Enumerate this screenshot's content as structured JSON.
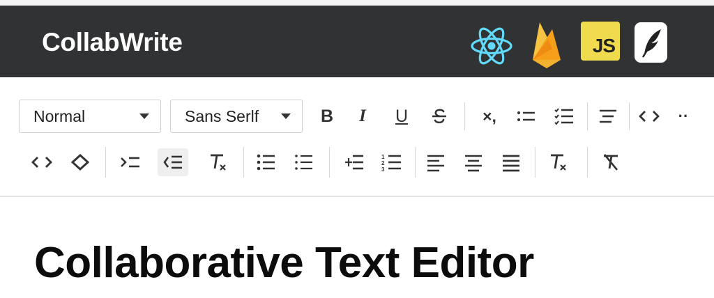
{
  "app": {
    "name": "CollabWrite",
    "tech_icons": [
      "react-icon",
      "firebase-icon",
      "javascript-icon",
      "quill-icon"
    ],
    "tech_js_label": "JS"
  },
  "toolbar": {
    "format_select": {
      "value": "Normal"
    },
    "font_select": {
      "value": "Sans Serlf"
    },
    "row1_buttons": [
      "bold",
      "italic",
      "underline",
      "strike",
      "subscript",
      "list-ordered",
      "list-check",
      "align",
      "code",
      "more"
    ],
    "row2_buttons": [
      "code-block",
      "color",
      "outdent",
      "indent",
      "clean",
      "list-bullet",
      "list-dash",
      "list-ordered-add",
      "list-numbered",
      "align-left",
      "align-center",
      "align-justify",
      "clear-format",
      "remove-format"
    ],
    "bold_label": "B",
    "italic_label": "I",
    "underline_label": "U",
    "subscript_label": "×,",
    "more_label": "··"
  },
  "document": {
    "title": "Collaborative Text Editor"
  },
  "colors": {
    "navbar": "#303234",
    "js_yellow": "#f0db4f",
    "react_blue": "#61dafb",
    "firebase_orange": "#f6a01a"
  }
}
